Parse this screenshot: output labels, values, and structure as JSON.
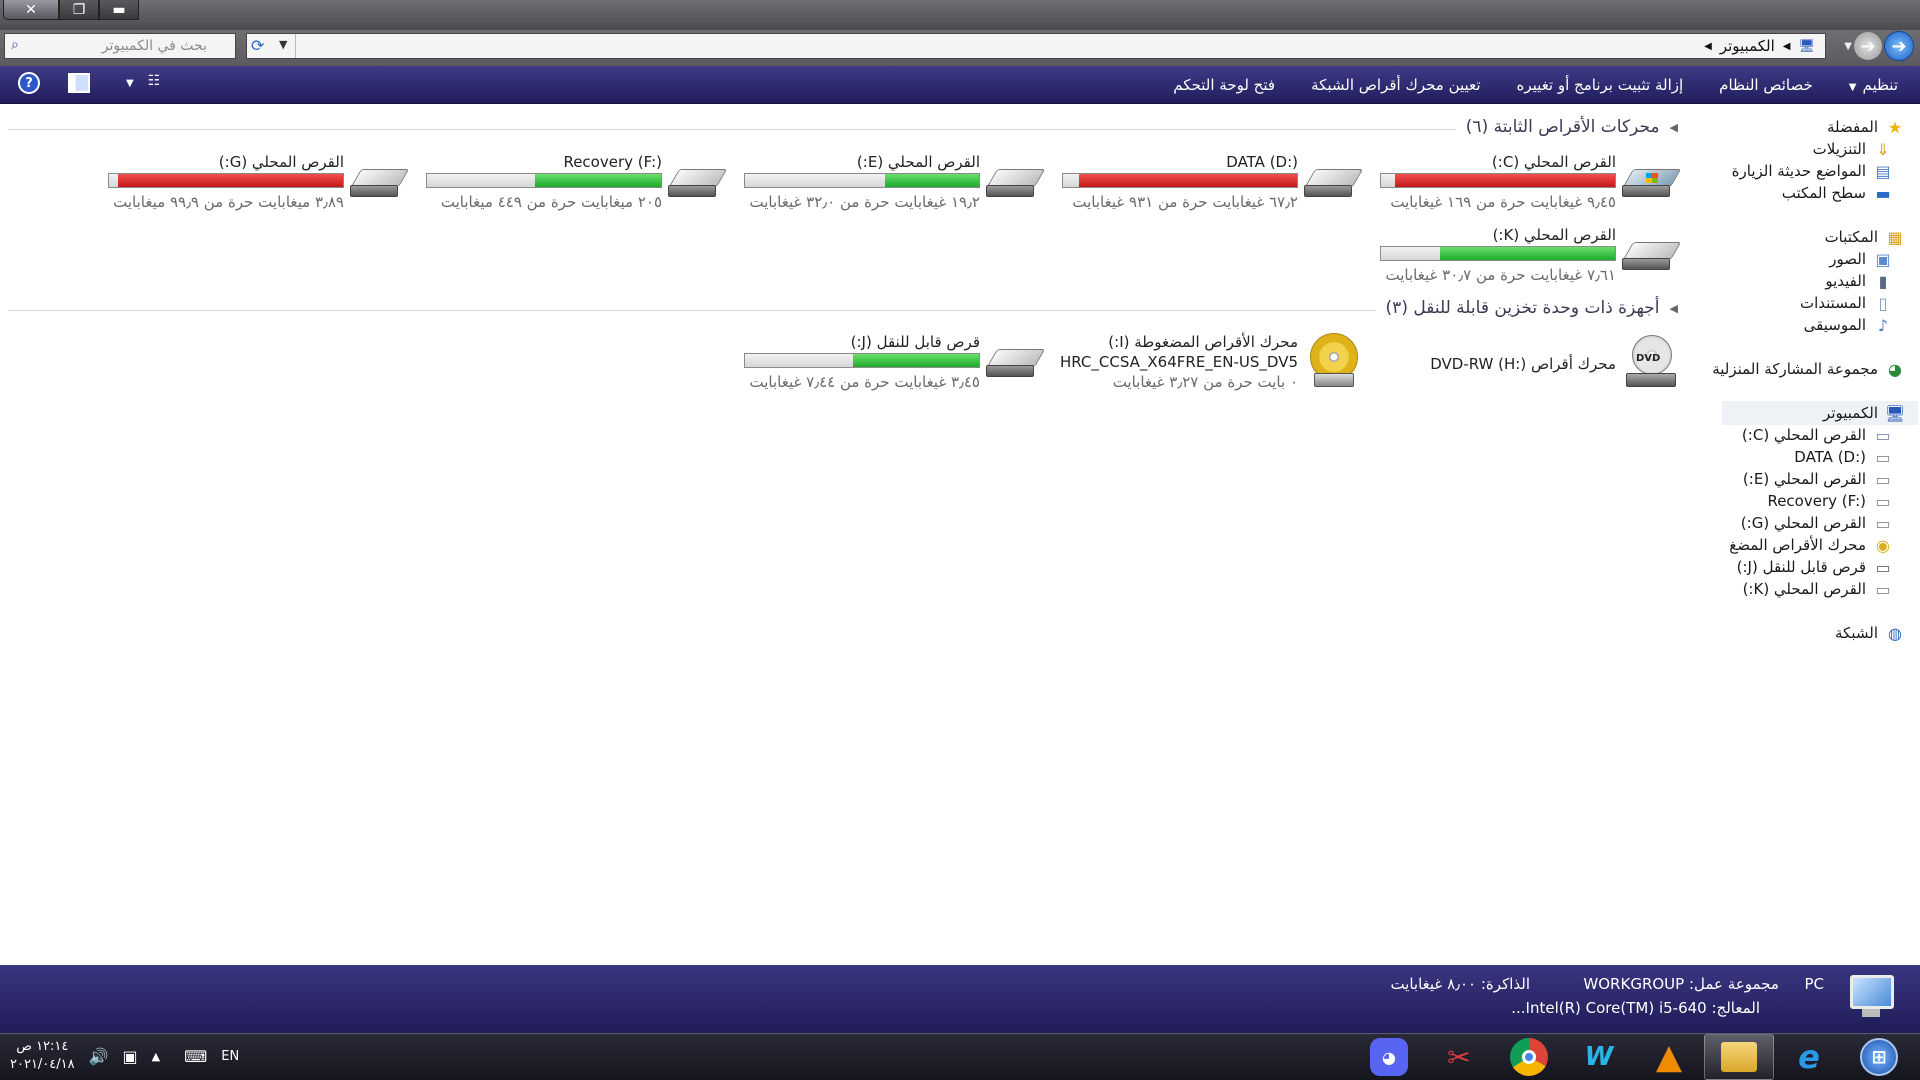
{
  "titlebar": {
    "close": "✕",
    "restore": "❐",
    "minimize": "▬"
  },
  "address": {
    "search_placeholder": "بحث في الكمبيوتر",
    "crumbs": [
      "الكمبيوتر"
    ]
  },
  "toolbar": {
    "items": [
      "تنظيم",
      "خصائص النظام",
      "إزالة تثبيت برنامج أو تغييره",
      "تعيين محرك أقراص الشبكة",
      "فتح لوحة التحكم"
    ],
    "help": "?"
  },
  "groups": {
    "fixed": {
      "title": "محركات الأقراص الثابتة (٦)"
    },
    "removable": {
      "title": "أجهزة ذات وحدة تخزين قابلة للنقل (٣)"
    }
  },
  "drives": [
    {
      "name": "القرص المحلي (C:)",
      "info": "٩٫٤٥ غيغابايت حرة من ١٦٩ غيغابايت",
      "used": 0.94,
      "color": "#c41818"
    },
    {
      "name": "DATA (D:)",
      "info": "٦٧٫٢ غيغابايت حرة من ٩٣١ غيغابايت",
      "used": 0.93,
      "color": "#c41818"
    },
    {
      "name": "القرص المحلي (E:)",
      "info": "١٩٫٢ غيغابايت حرة من ٣٢٫٠ غيغابايت",
      "used": 0.4,
      "color": "#1eaa2a"
    },
    {
      "name": "Recovery (F:)",
      "info": "٢٠٥ ميغابايت حرة من ٤٤٩ ميغابايت",
      "used": 0.54,
      "color": "#1eaa2a"
    },
    {
      "name": "القرص المحلي (G:)",
      "info": "٣٫٨٩ ميغابايت حرة من ٩٩٫٩ ميغابايت",
      "used": 0.96,
      "color": "#c41818"
    },
    {
      "name": "القرص المحلي (K:)",
      "info": "٧٫٦١ غيغابايت حرة من ٣٠٫٧ غيغابايت",
      "used": 0.75,
      "color": "#1eaa2a"
    }
  ],
  "removable": [
    {
      "name": "محرك أقراص DVD-RW (H:)"
    },
    {
      "name": "محرك الأقراص المضغوطة (I:)",
      "sub": "HRC_CCSA_X64FRE_EN-US_DV5",
      "info": "٠ بايت حرة من ٣٫٢٧ غيغابايت"
    },
    {
      "name": "قرص قابل للنقل (J:)",
      "info": "٣٫٤٥ غيغابايت حرة من ٧٫٤٤ غيغابايت",
      "used": 0.54,
      "color": "#1eaa2a"
    }
  ],
  "nav": {
    "favorites": "المفضلة",
    "downloads": "التنزيلات",
    "recent": "المواضع حديثة الزيارة",
    "desktop": "سطح المكتب",
    "libraries": "المكتبات",
    "pictures": "الصور",
    "videos": "الفيديو",
    "documents": "المستندات",
    "music": "الموسيقى",
    "homegroup": "مجموعة المشاركة المنزلية",
    "computer": "الكمبيوتر",
    "c": "القرص المحلي (C:)",
    "d": "DATA (D:)",
    "e": "القرص المحلي (E:)",
    "f": "Recovery (F:)",
    "g": "القرص المحلي (G:)",
    "i": "محرك الأقراص المضغ",
    "j": "قرص قابل للنقل (J:)",
    "k": "القرص المحلي (K:)",
    "network": "الشبكة"
  },
  "details": {
    "pc": "PC",
    "workgroup": "مجموعة عمل: WORKGROUP",
    "memory": "الذاكرة: ٨٫٠٠ غيغابايت",
    "processor": "المعالج: Intel(R) Core(TM) i5-640..."
  },
  "taskbar": {
    "time": "١٢:١٤ ص",
    "date": "٢٠٢١/٠٤/١٨",
    "lang": "EN"
  }
}
